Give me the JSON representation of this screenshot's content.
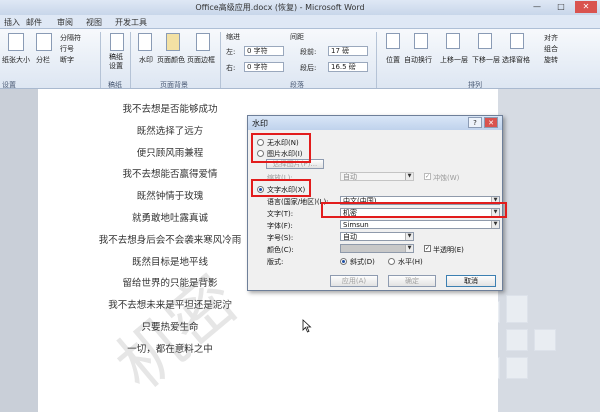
{
  "window": {
    "title": "Office高级应用.docx (恢复) - Microsoft Word",
    "controls": [
      "—",
      "□",
      "✕"
    ]
  },
  "ribbon": {
    "tabs": [
      "插入",
      "邮件",
      "审阅",
      "视图",
      "开发工具"
    ],
    "page_setup": {
      "buttons": [
        "纸张大小",
        "分栏",
        "分隔符",
        "行号",
        "断字"
      ],
      "group_label": "设置"
    },
    "manuscript": {
      "label": "稿纸\n设置",
      "group_label": "稿纸"
    },
    "background": {
      "buttons": [
        "水印",
        "页面颜色",
        "页面边框"
      ],
      "group_label": "页面背景"
    },
    "paragraph": {
      "indent_header": "缩进",
      "spacing_header": "间距",
      "left_label": "左:",
      "left_value": "0 字符",
      "right_label": "右:",
      "right_value": "0 字符",
      "before_label": "段前:",
      "before_value": "17 磅",
      "after_label": "段后:",
      "after_value": "16.5 磅",
      "group_label": "段落"
    },
    "arrange": {
      "buttons": [
        "位置",
        "自动换行",
        "上移一层",
        "下移一层",
        "选择窗格"
      ],
      "small_buttons": [
        "对齐",
        "组合",
        "旋转"
      ],
      "group_label": "排列"
    }
  },
  "document": {
    "watermark_text": "机密",
    "lines": [
      "我不去想是否能够成功",
      "既然选择了远方",
      "便只顾风雨兼程",
      "我不去想能否赢得爱情",
      "既然钟情于玫瑰",
      "就勇敢地吐露真诚",
      "我不去想身后会不会袭来寒风冷雨",
      "既然目标是地平线",
      "留给世界的只能是背影",
      "我不去想未来是平坦还是泥泞",
      "只要热爱生命",
      "一切，都在意料之中"
    ]
  },
  "dialog": {
    "title": "水印",
    "help": "?",
    "close": "✕",
    "option_none": "无水印(N)",
    "option_picture": "图片水印(I)",
    "select_picture": "选择图片(P)...",
    "scale_label": "缩放(L):",
    "scale_value": "自动",
    "washout_label": "冲蚀(W)",
    "option_text": "文字水印(X)",
    "language_label": "语言(国家/地区)(L):",
    "language_value": "中文(中国)",
    "text_label": "文字(T):",
    "text_value": "机密",
    "font_label": "字体(F):",
    "font_value": "Simsun",
    "size_label": "字号(S):",
    "size_value": "自动",
    "color_label": "颜色(C):",
    "semitransparent_label": "半透明(E)",
    "layout_label": "版式:",
    "diagonal_label": "斜式(D)",
    "horizontal_label": "水平(H)",
    "apply_button": "应用(A)",
    "ok_button": "确定",
    "cancel_button": "取消",
    "selected_option": "text",
    "washout_checked": true,
    "semitransparent_checked": true,
    "layout_selected": "diagonal"
  },
  "colors": {
    "highlight": "#e21c1c",
    "ribbon_bg": "#dde6f2",
    "watermark": "#e6e6e6"
  }
}
